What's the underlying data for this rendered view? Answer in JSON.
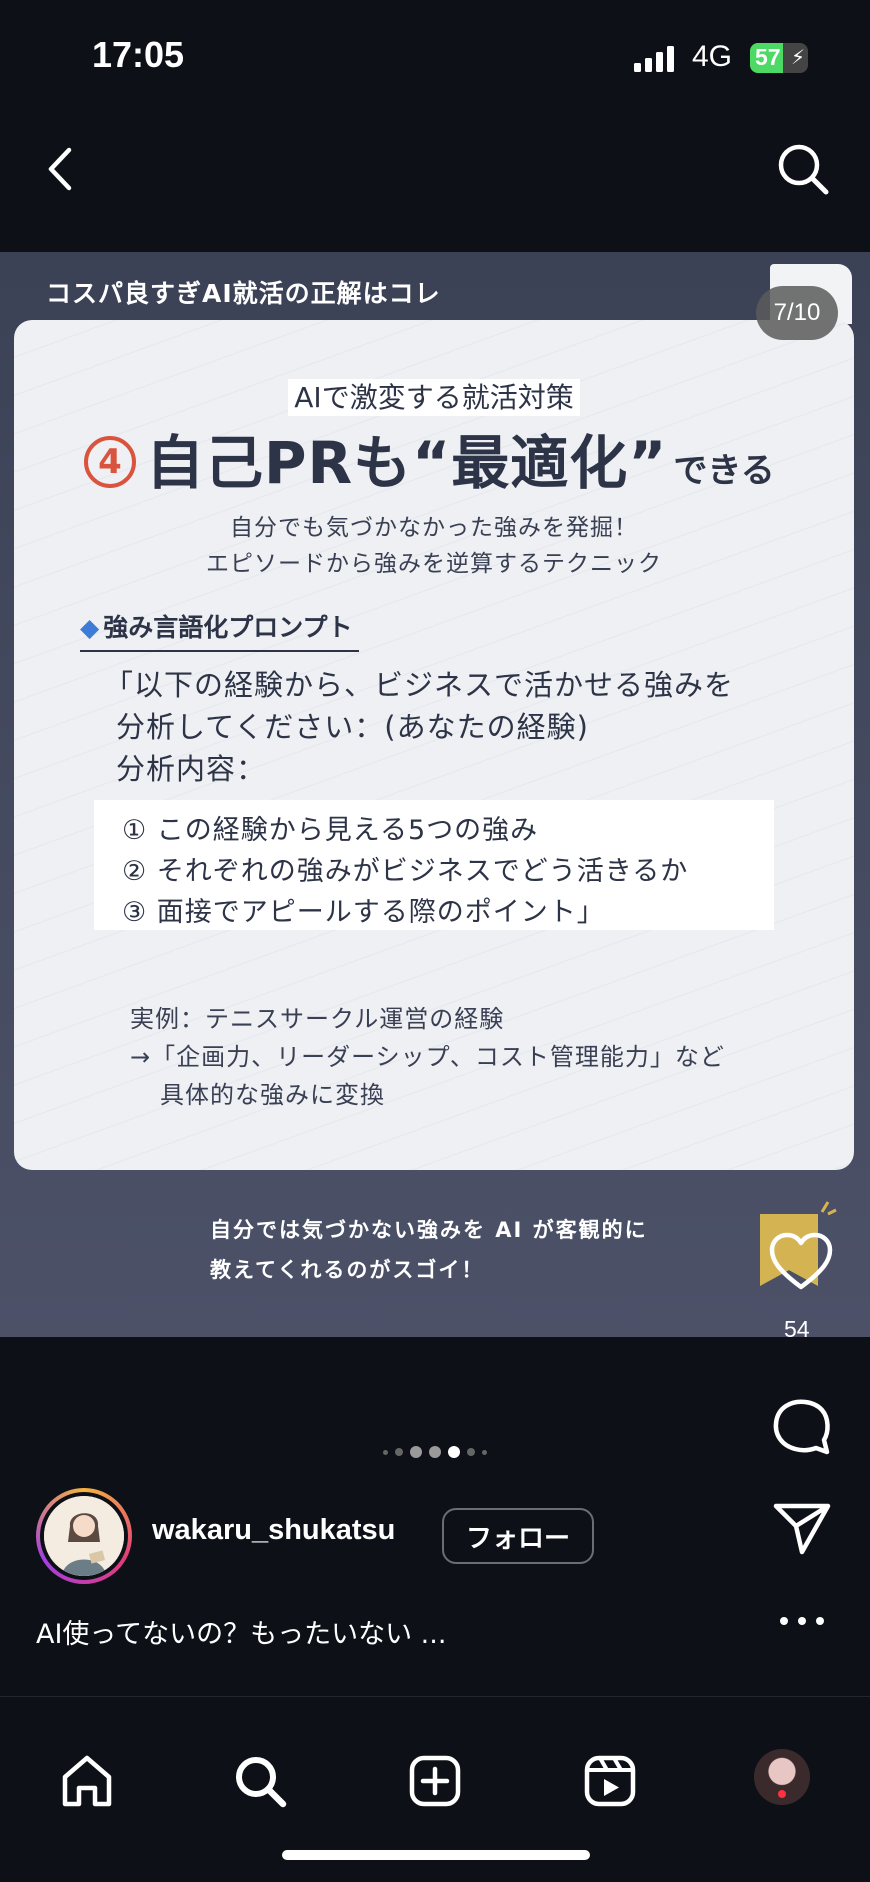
{
  "status": {
    "time": "17:05",
    "network": "4G",
    "battery": "57",
    "battery_level": 0.57
  },
  "post": {
    "header": "コスパ良すぎAI就活の正解はコレ",
    "page_counter": "7/10",
    "subtitle": "AIで激変する就活対策",
    "title_number": "4",
    "title_main": "自己PRも“最適化”",
    "title_suffix": "できる",
    "description": [
      "自分でも気づかなかった強みを発掘！",
      "エピソードから強みを逆算するテクニック"
    ],
    "prompt_label": "強み言語化プロンプト",
    "prompt_lines": [
      "「以下の経験から、ビジネスで活かせる強みを",
      "分析してください：(あなたの経験)",
      "分析内容："
    ],
    "list_items": [
      "① この経験から見える5つの強み",
      "② それぞれの強みがビジネスでどう活きるか",
      "③ 面接でアピールする際のポイント」"
    ],
    "example_lines": [
      "実例：テニスサークル運営の経験",
      "→「企画力、リーダーシップ、コスト管理能力」など",
      "具体的な強みに変換"
    ],
    "footer_lines": [
      "自分では気づかない強みを AI が客観的に",
      "教えてくれるのがスゴイ！"
    ]
  },
  "actions": {
    "like_count": "54"
  },
  "carousel": {
    "dot_count": 7,
    "active_index": 4
  },
  "profile": {
    "username": "wakaru_shukatsu",
    "follow_label": "フォロー"
  },
  "caption": "AI使ってないの？もったいない ..."
}
